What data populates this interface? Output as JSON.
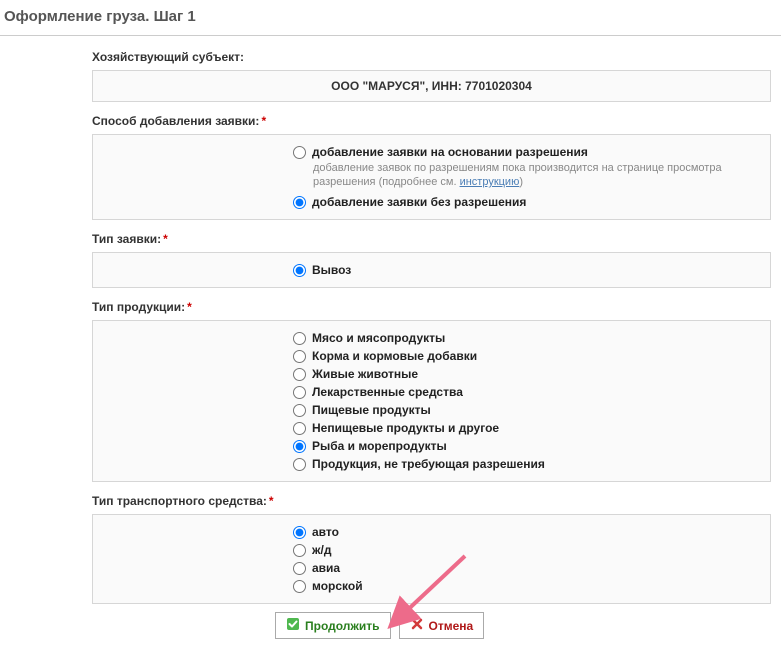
{
  "page": {
    "title": "Оформление груза. Шаг 1"
  },
  "subject": {
    "label": "Хозяйствующий субъект:",
    "value": "ООО \"МАРУСЯ\", ИНН: 7701020304"
  },
  "addMethod": {
    "label": "Способ добавления заявки:",
    "options": [
      {
        "label": "добавление заявки на основании разрешения",
        "checked": false,
        "helper_prefix": "добавление заявок по разрешениям пока производится на странице просмотра разрешения (подробнее см. ",
        "helper_link": "инструкцию",
        "helper_suffix": ")"
      },
      {
        "label": "добавление заявки без разрешения",
        "checked": true
      }
    ]
  },
  "requestType": {
    "label": "Тип заявки:",
    "options": [
      {
        "label": "Вывоз",
        "checked": true
      }
    ]
  },
  "productType": {
    "label": "Тип продукции:",
    "options": [
      {
        "label": "Мясо и мясопродукты",
        "checked": false
      },
      {
        "label": "Корма и кормовые добавки",
        "checked": false
      },
      {
        "label": "Живые животные",
        "checked": false
      },
      {
        "label": "Лекарственные средства",
        "checked": false
      },
      {
        "label": "Пищевые продукты",
        "checked": false
      },
      {
        "label": "Непищевые продукты и другое",
        "checked": false
      },
      {
        "label": "Рыба и морепродукты",
        "checked": true
      },
      {
        "label": "Продукция, не требующая разрешения",
        "checked": false
      }
    ]
  },
  "transportType": {
    "label": "Тип транспортного средства:",
    "options": [
      {
        "label": "авто",
        "checked": true
      },
      {
        "label": "ж/д",
        "checked": false
      },
      {
        "label": "авиа",
        "checked": false
      },
      {
        "label": "морской",
        "checked": false
      }
    ]
  },
  "buttons": {
    "continue": "Продолжить",
    "cancel": "Отмена"
  }
}
